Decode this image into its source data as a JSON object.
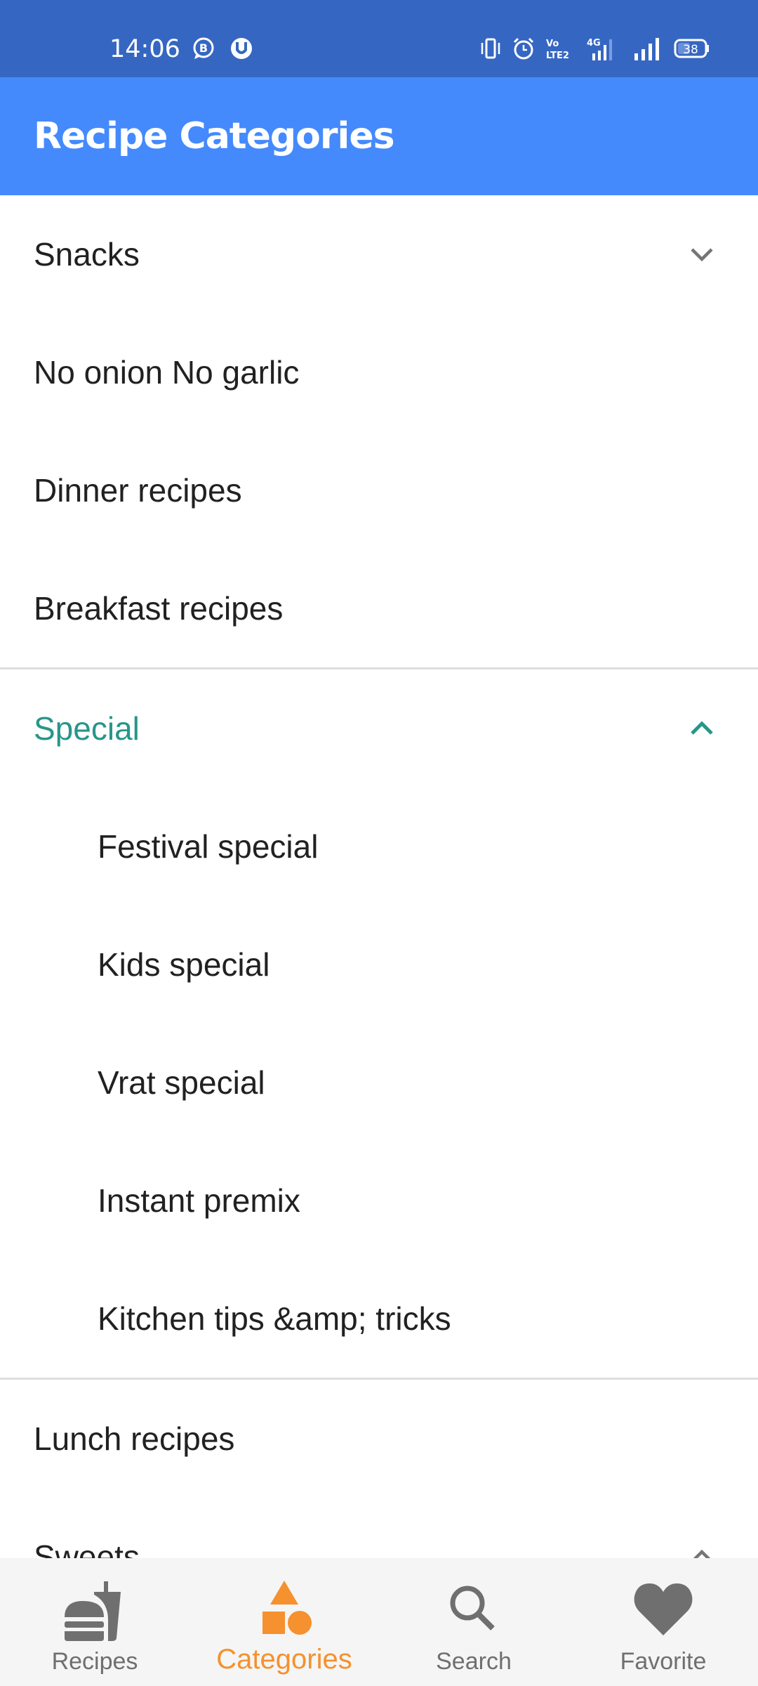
{
  "status_bar": {
    "time": "14:06",
    "left_icons": [
      "b-chat-icon",
      "utorrent-icon"
    ],
    "right_icons": [
      "vibrate-icon",
      "alarm-icon",
      "volte-icon",
      "signal-4g-icon",
      "signal-icon",
      "battery-icon"
    ],
    "network": "4G",
    "volte": "Vo LTE2",
    "battery": "38"
  },
  "app_bar": {
    "title": "Recipe Categories"
  },
  "categories": [
    {
      "label": "Snacks",
      "expandable": true,
      "expanded": false
    },
    {
      "label": "No onion No garlic"
    },
    {
      "label": "Dinner recipes"
    },
    {
      "label": "Breakfast recipes"
    },
    {
      "label": "Special",
      "expandable": true,
      "expanded": true,
      "children": [
        {
          "label": "Festival special"
        },
        {
          "label": "Kids special"
        },
        {
          "label": "Vrat special"
        },
        {
          "label": "Instant premix"
        },
        {
          "label": "Kitchen tips &amp; tricks"
        }
      ]
    },
    {
      "label": "Lunch recipes"
    },
    {
      "label": "Sweets",
      "expandable": true,
      "expanded": true
    }
  ],
  "bottom_nav": {
    "items": [
      {
        "label": "Recipes",
        "icon": "fastfood-icon",
        "active": false
      },
      {
        "label": "Categories",
        "icon": "category-shapes-icon",
        "active": true
      },
      {
        "label": "Search",
        "icon": "search-icon",
        "active": false
      },
      {
        "label": "Favorite",
        "icon": "heart-icon",
        "active": false
      }
    ]
  },
  "colors": {
    "status_bar": "#3567c2",
    "app_bar": "#448afc",
    "active_category": "#27968a",
    "active_nav": "#f5912e",
    "inactive_nav": "#6f6f6f"
  }
}
